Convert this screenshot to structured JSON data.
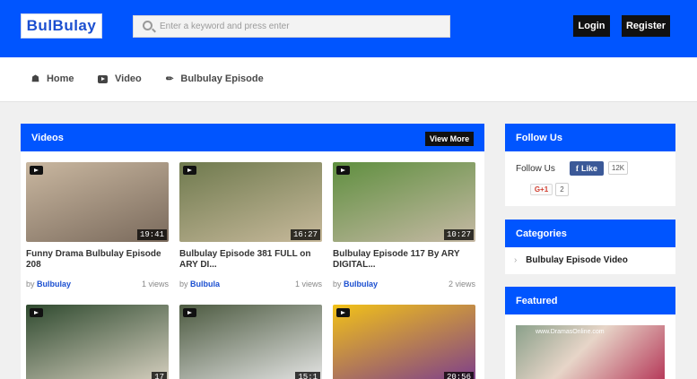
{
  "header": {
    "logo_text": "BulBulay",
    "search_placeholder": "Enter a keyword and press enter",
    "login_label": "Login",
    "register_label": "Register"
  },
  "nav": {
    "items": [
      {
        "label": "Home",
        "icon": "home-icon"
      },
      {
        "label": "Video",
        "icon": "video-icon"
      },
      {
        "label": "Bulbulay Episode",
        "icon": "pin-icon"
      }
    ]
  },
  "videos": {
    "title": "Videos",
    "view_more_label": "View More",
    "by_label": "by",
    "items": [
      {
        "title": "Funny Drama Bulbulay Episode 208",
        "author": "Bulbulay",
        "views": "1 views",
        "duration": "19:41",
        "thumb_colors": [
          "#c9b7a0",
          "#7a6a5c"
        ]
      },
      {
        "title": "Bulbulay Episode 381 FULL on ARY DI...",
        "author": "Bulbula",
        "views": "1 views",
        "duration": "16:27",
        "thumb_colors": [
          "#6f7a4e",
          "#c7b99b"
        ]
      },
      {
        "title": "Bulbulay Episode 117 By ARY DIGITAL...",
        "author": "Bulbulay",
        "views": "2 views",
        "duration": "10:27",
        "thumb_colors": [
          "#5f8f3f",
          "#c6b9a5"
        ]
      },
      {
        "title": "",
        "author": "",
        "views": "",
        "duration": "17",
        "thumb_colors": [
          "#2f4a2f",
          "#d9d2c2"
        ]
      },
      {
        "title": "",
        "author": "",
        "views": "",
        "duration": "15:1",
        "thumb_colors": [
          "#4c5a40",
          "#e8e8e8"
        ]
      },
      {
        "title": "",
        "author": "",
        "views": "",
        "duration": "20:56",
        "thumb_colors": [
          "#f2c218",
          "#7b3b8e"
        ]
      }
    ]
  },
  "follow": {
    "title": "Follow Us",
    "label": "Follow Us",
    "fb_label": "Like",
    "fb_count": "12K",
    "gplus_label": "G+1",
    "gplus_count": "2"
  },
  "categories": {
    "title": "Categories",
    "items": [
      "Bulbulay Episode Video"
    ]
  },
  "featured": {
    "title": "Featured"
  },
  "colors": {
    "brand_blue": "#0055ff",
    "dark_button": "#111111",
    "link_blue": "#1b4fd0"
  }
}
